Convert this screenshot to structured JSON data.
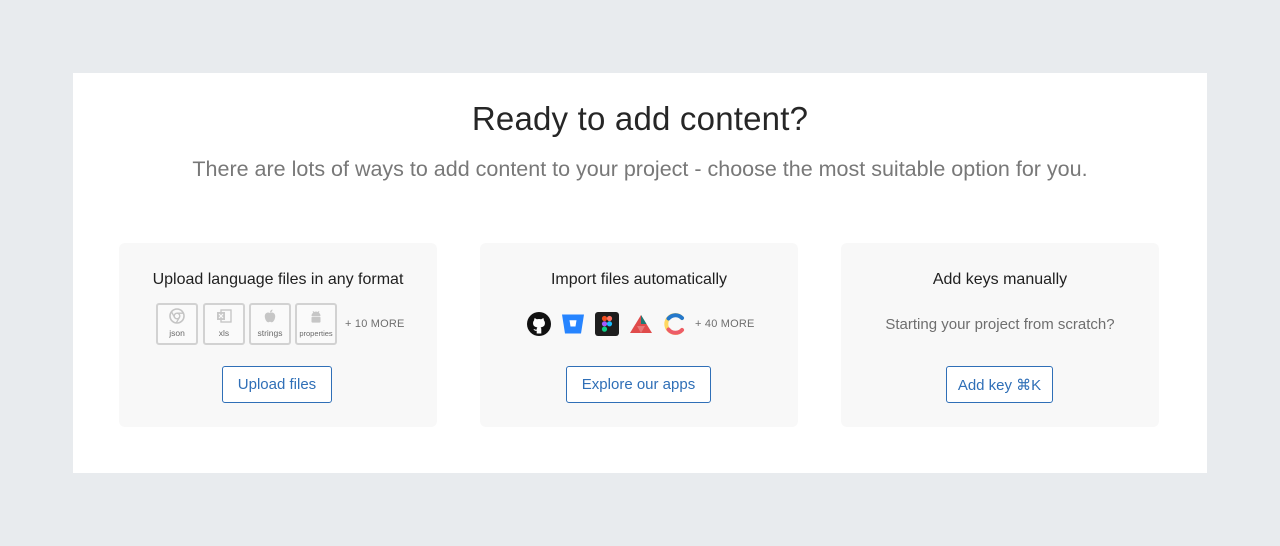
{
  "header": {
    "title": "Ready to add content?",
    "subtitle": "There are lots of ways to add content to your project - choose the most suitable option for you."
  },
  "cards": [
    {
      "title": "Upload language files in any format",
      "file_types": [
        {
          "label": "json",
          "icon": "chrome-icon"
        },
        {
          "label": "xls",
          "icon": "excel-icon"
        },
        {
          "label": "strings",
          "icon": "apple-icon"
        },
        {
          "label": "properties",
          "icon": "android-icon"
        }
      ],
      "more": "+ 10 MORE",
      "button": "Upload files"
    },
    {
      "title": "Import files automatically",
      "apps": [
        "github-icon",
        "bitbucket-icon",
        "figma-icon",
        "triangle-app-icon",
        "contentful-icon"
      ],
      "more": "+ 40 MORE",
      "button": "Explore our apps"
    },
    {
      "title": "Add keys manually",
      "text": "Starting your project from scratch?",
      "button": "Add key ⌘K"
    }
  ],
  "colors": {
    "background": "#e8ebee",
    "panel": "#ffffff",
    "card": "#f8f8f8",
    "accent": "#2f6fb7"
  }
}
